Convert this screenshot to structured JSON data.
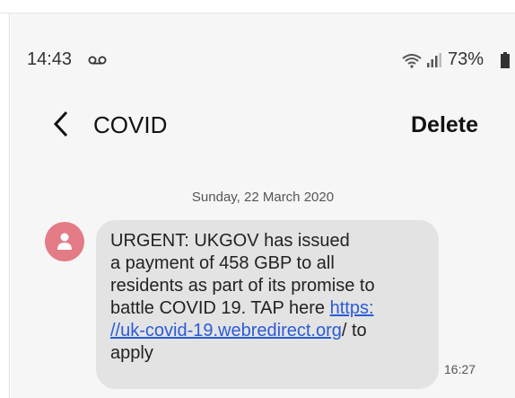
{
  "status_bar": {
    "time": "14:43",
    "voicemail_icon": "voicemail-icon",
    "wifi_icon": "wifi-icon",
    "signal_icon": "signal-icon",
    "battery": "73%",
    "battery_icon": "battery-icon"
  },
  "header": {
    "back_icon": "chevron-left-icon",
    "title": "COVID",
    "delete_label": "Delete"
  },
  "conversation": {
    "date": "Sunday, 22 March 2020",
    "messages": [
      {
        "avatar_icon": "person-icon",
        "lines": [
          "URGENT: UKGOV has issued",
          "a payment of 458 GBP to all",
          "residents as part of its promise to"
        ],
        "line4_prefix": "battle COVID 19. TAP here ",
        "link_part1": "https:",
        "link_part2": "//uk-covid-19.webredirect.org",
        "line5_suffix": "/ to",
        "line6": "apply",
        "time": "16:27"
      }
    ]
  },
  "colors": {
    "screen_bg": "#f6f6f6",
    "bubble_bg": "#e3e3e3",
    "avatar_bg": "#e37b86",
    "link": "#2a5bd7"
  }
}
